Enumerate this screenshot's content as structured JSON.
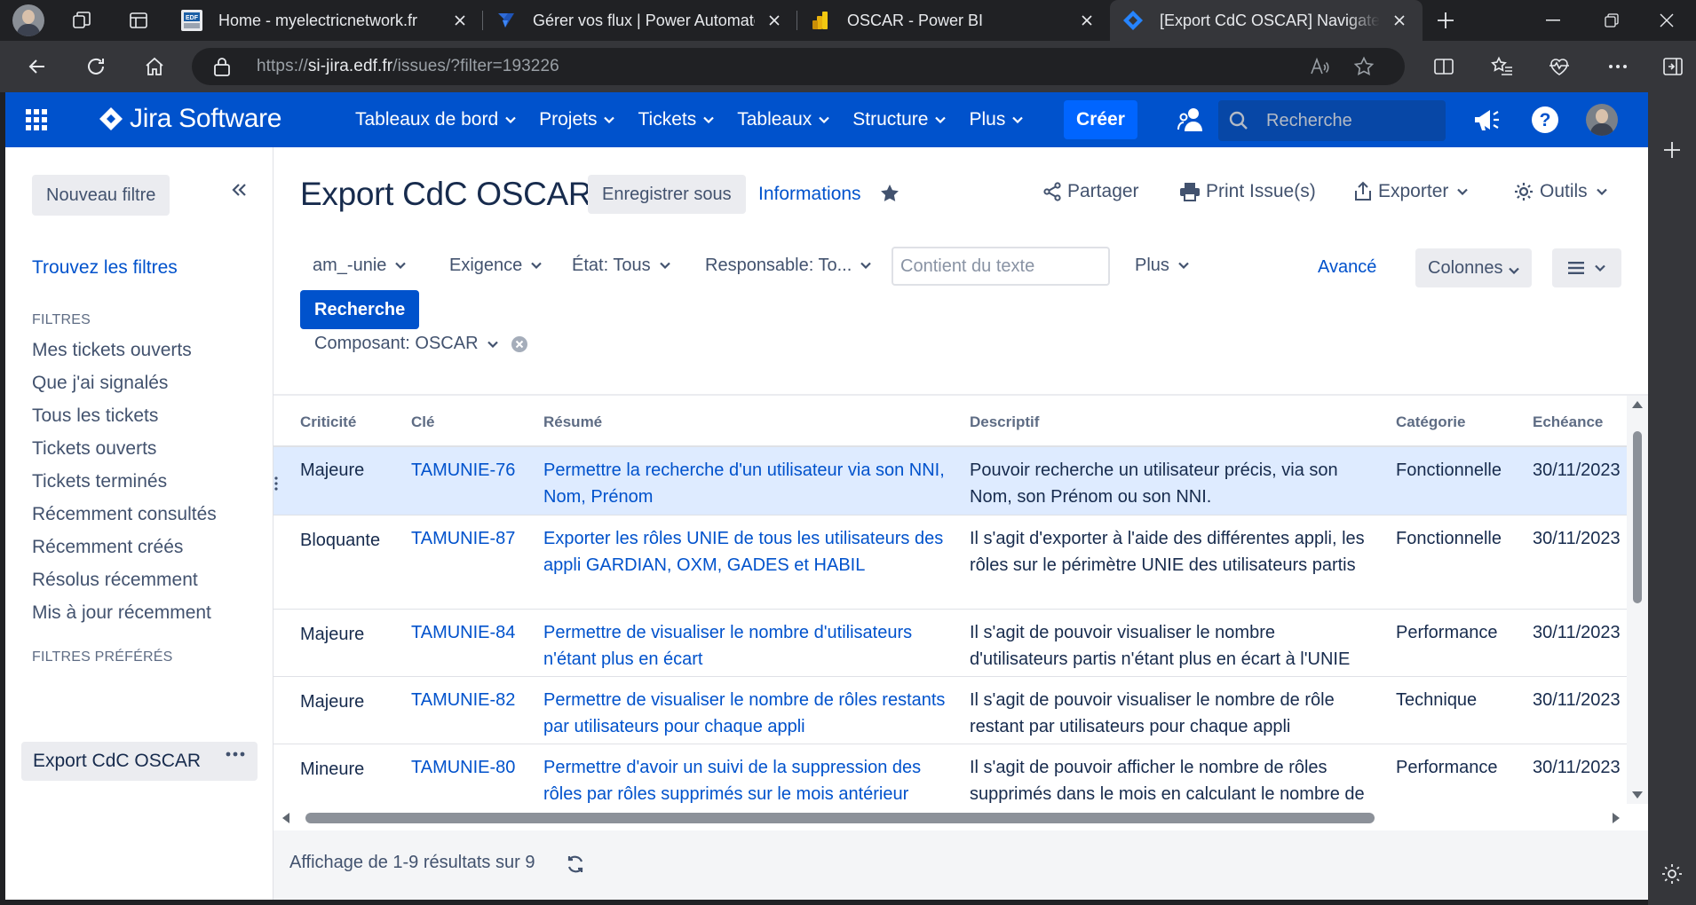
{
  "browser": {
    "tabs": [
      {
        "title": "Home - myelectricnetwork.fr",
        "icon": "edf-favicon"
      },
      {
        "title": "Gérer vos flux | Power Automate",
        "icon": "power-automate-favicon"
      },
      {
        "title": "OSCAR - Power BI",
        "icon": "power-bi-favicon"
      },
      {
        "title": "[Export CdC OSCAR] Navigateur",
        "icon": "jira-favicon",
        "active": true
      }
    ],
    "url_prefix": "https://",
    "url_domain": "si-jira.edf.fr",
    "url_path": "/issues/?filter=193226"
  },
  "jira": {
    "brand": "Jira Software",
    "menu": [
      "Tableaux de bord",
      "Projets",
      "Tickets",
      "Tableaux",
      "Structure",
      "Plus"
    ],
    "create_label": "Créer",
    "search_placeholder": "Recherche"
  },
  "sidebar": {
    "new_filter": "Nouveau filtre",
    "find_filters": "Trouvez les filtres",
    "filters_heading": "FILTRES",
    "filters": [
      "Mes tickets ouverts",
      "Que j'ai signalés",
      "Tous les tickets",
      "Tickets ouverts",
      "Tickets terminés",
      "Récemment consultés",
      "Récemment créés",
      "Résolus récemment",
      "Mis à jour récemment"
    ],
    "favorites_heading": "FILTRES PRÉFÉRÉS",
    "favorite": "Export CdC OSCAR"
  },
  "header": {
    "title": "Export CdC OSCAR",
    "save_as": "Enregistrer sous",
    "info": "Informations",
    "share": "Partager",
    "print": "Print Issue(s)",
    "export": "Exporter",
    "tools": "Outils"
  },
  "filters": {
    "project": "am_-unie",
    "type": "Exigence",
    "status": "État: Tous",
    "assignee": "Responsable: To...",
    "text_placeholder": "Contient du texte",
    "more": "Plus",
    "advanced": "Avancé",
    "columns": "Colonnes",
    "search_button": "Recherche",
    "component": "Composant: OSCAR"
  },
  "table": {
    "columns": [
      "Criticité",
      "Clé",
      "Résumé",
      "Descriptif",
      "Catégorie",
      "Echéance"
    ],
    "rows": [
      {
        "criticite": "Majeure",
        "cle": "TAMUNIE-76",
        "resume": "Permettre la recherche d'un utilisateur via son NNI, Nom, Prénom",
        "descriptif": "Pouvoir recherche un utilisateur précis, via son Nom, son Prénom ou son NNI.",
        "categorie": "Fonctionnelle",
        "echeance": "30/11/2023"
      },
      {
        "criticite": "Bloquante",
        "cle": "TAMUNIE-87",
        "resume": "Exporter les rôles UNIE de tous les utilisateurs des appli GARDIAN, OXM, GADES et HABIL",
        "descriptif": "Il s'agit d'exporter à l'aide des différentes appli, les rôles sur le périmètre UNIE des utilisateurs partis",
        "categorie": "Fonctionnelle",
        "echeance": "30/11/2023"
      },
      {
        "criticite": "Majeure",
        "cle": "TAMUNIE-84",
        "resume": "Permettre de visualiser le nombre d'utilisateurs n'étant plus en écart",
        "descriptif": "Il s'agit de pouvoir visualiser le nombre d'utilisateurs partis n'étant plus en écart à l'UNIE",
        "categorie": "Performance",
        "echeance": "30/11/2023"
      },
      {
        "criticite": "Majeure",
        "cle": "TAMUNIE-82",
        "resume": "Permettre de visualiser le nombre de rôles restants par utilisateurs pour chaque appli",
        "descriptif": "Il s'agit de pouvoir visualiser le nombre de rôle restant par utilisateurs pour chaque appli",
        "categorie": "Technique",
        "echeance": "30/11/2023"
      },
      {
        "criticite": "Mineure",
        "cle": "TAMUNIE-80",
        "resume": "Permettre d'avoir un suivi de la suppression des rôles par rôles supprimés sur le mois antérieur",
        "descriptif": "Il s'agit de pouvoir afficher le nombre de rôles supprimés dans le mois en calculant le nombre de rôles dont la date de suppression est comprise dans le mois antérieur",
        "categorie": "Performance",
        "echeance": "30/11/2023"
      }
    ]
  },
  "footer": {
    "results": "Affichage de 1-9 résultats sur 9"
  },
  "colors": {
    "jira_blue": "#0052cc",
    "selected_row": "#deebff",
    "browser_dark": "#202124"
  }
}
